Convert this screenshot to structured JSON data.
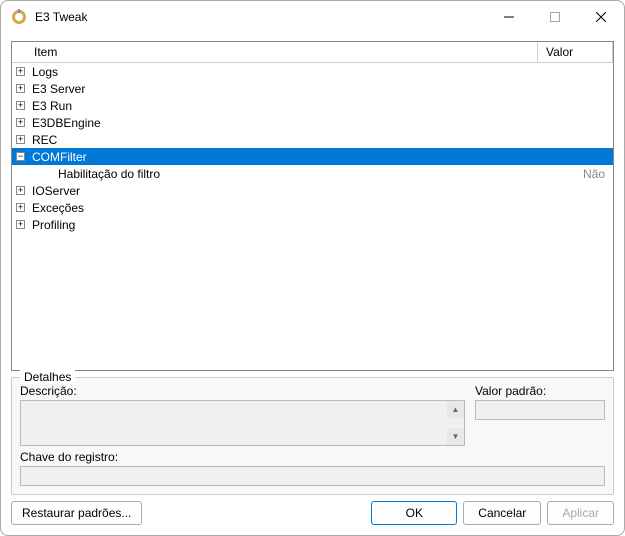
{
  "window": {
    "title": "E3 Tweak"
  },
  "tree": {
    "header": {
      "item": "Item",
      "valor": "Valor"
    },
    "rows": [
      {
        "label": "Logs",
        "expandable": true,
        "expanded": false,
        "selected": false
      },
      {
        "label": "E3 Server",
        "expandable": true,
        "expanded": false,
        "selected": false
      },
      {
        "label": "E3 Run",
        "expandable": true,
        "expanded": false,
        "selected": false
      },
      {
        "label": "E3DBEngine",
        "expandable": true,
        "expanded": false,
        "selected": false
      },
      {
        "label": "REC",
        "expandable": true,
        "expanded": false,
        "selected": false
      },
      {
        "label": "COMFilter",
        "expandable": true,
        "expanded": true,
        "selected": true
      },
      {
        "label": "Habilitação do filtro",
        "expandable": false,
        "child": true,
        "value": "Não"
      },
      {
        "label": "IOServer",
        "expandable": true,
        "expanded": false,
        "selected": false
      },
      {
        "label": "Exceções",
        "expandable": true,
        "expanded": false,
        "selected": false
      },
      {
        "label": "Profiling",
        "expandable": true,
        "expanded": false,
        "selected": false
      }
    ]
  },
  "details": {
    "legend": "Detalhes",
    "descLabel": "Descrição:",
    "valorPadraoLabel": "Valor padrão:",
    "chaveLabel": "Chave do registro:",
    "descValue": "",
    "valorPadraoValue": "",
    "chaveValue": ""
  },
  "buttons": {
    "restore": "Restaurar padrões...",
    "ok": "OK",
    "cancel": "Cancelar",
    "apply": "Aplicar"
  },
  "glyphs": {
    "plus": "+",
    "minus": "−",
    "upArrow": "▲",
    "downArrow": "▼"
  }
}
